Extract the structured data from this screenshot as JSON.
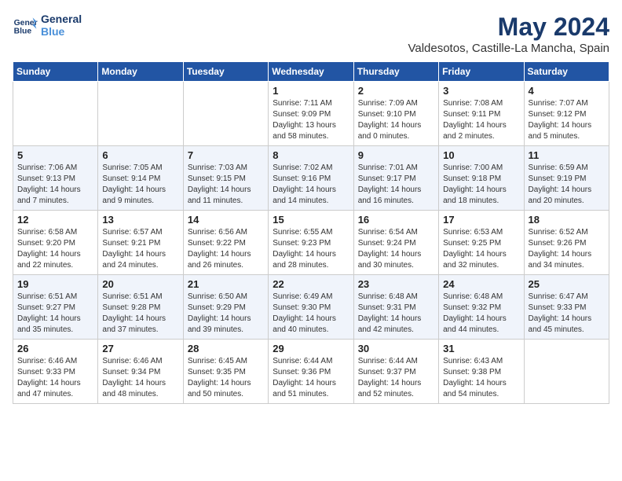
{
  "header": {
    "logo_line1": "General",
    "logo_line2": "Blue",
    "month": "May 2024",
    "location": "Valdesotos, Castille-La Mancha, Spain"
  },
  "days_of_week": [
    "Sunday",
    "Monday",
    "Tuesday",
    "Wednesday",
    "Thursday",
    "Friday",
    "Saturday"
  ],
  "weeks": [
    [
      {
        "day": "",
        "info": ""
      },
      {
        "day": "",
        "info": ""
      },
      {
        "day": "",
        "info": ""
      },
      {
        "day": "1",
        "info": "Sunrise: 7:11 AM\nSunset: 9:09 PM\nDaylight: 13 hours\nand 58 minutes."
      },
      {
        "day": "2",
        "info": "Sunrise: 7:09 AM\nSunset: 9:10 PM\nDaylight: 14 hours\nand 0 minutes."
      },
      {
        "day": "3",
        "info": "Sunrise: 7:08 AM\nSunset: 9:11 PM\nDaylight: 14 hours\nand 2 minutes."
      },
      {
        "day": "4",
        "info": "Sunrise: 7:07 AM\nSunset: 9:12 PM\nDaylight: 14 hours\nand 5 minutes."
      }
    ],
    [
      {
        "day": "5",
        "info": "Sunrise: 7:06 AM\nSunset: 9:13 PM\nDaylight: 14 hours\nand 7 minutes."
      },
      {
        "day": "6",
        "info": "Sunrise: 7:05 AM\nSunset: 9:14 PM\nDaylight: 14 hours\nand 9 minutes."
      },
      {
        "day": "7",
        "info": "Sunrise: 7:03 AM\nSunset: 9:15 PM\nDaylight: 14 hours\nand 11 minutes."
      },
      {
        "day": "8",
        "info": "Sunrise: 7:02 AM\nSunset: 9:16 PM\nDaylight: 14 hours\nand 14 minutes."
      },
      {
        "day": "9",
        "info": "Sunrise: 7:01 AM\nSunset: 9:17 PM\nDaylight: 14 hours\nand 16 minutes."
      },
      {
        "day": "10",
        "info": "Sunrise: 7:00 AM\nSunset: 9:18 PM\nDaylight: 14 hours\nand 18 minutes."
      },
      {
        "day": "11",
        "info": "Sunrise: 6:59 AM\nSunset: 9:19 PM\nDaylight: 14 hours\nand 20 minutes."
      }
    ],
    [
      {
        "day": "12",
        "info": "Sunrise: 6:58 AM\nSunset: 9:20 PM\nDaylight: 14 hours\nand 22 minutes."
      },
      {
        "day": "13",
        "info": "Sunrise: 6:57 AM\nSunset: 9:21 PM\nDaylight: 14 hours\nand 24 minutes."
      },
      {
        "day": "14",
        "info": "Sunrise: 6:56 AM\nSunset: 9:22 PM\nDaylight: 14 hours\nand 26 minutes."
      },
      {
        "day": "15",
        "info": "Sunrise: 6:55 AM\nSunset: 9:23 PM\nDaylight: 14 hours\nand 28 minutes."
      },
      {
        "day": "16",
        "info": "Sunrise: 6:54 AM\nSunset: 9:24 PM\nDaylight: 14 hours\nand 30 minutes."
      },
      {
        "day": "17",
        "info": "Sunrise: 6:53 AM\nSunset: 9:25 PM\nDaylight: 14 hours\nand 32 minutes."
      },
      {
        "day": "18",
        "info": "Sunrise: 6:52 AM\nSunset: 9:26 PM\nDaylight: 14 hours\nand 34 minutes."
      }
    ],
    [
      {
        "day": "19",
        "info": "Sunrise: 6:51 AM\nSunset: 9:27 PM\nDaylight: 14 hours\nand 35 minutes."
      },
      {
        "day": "20",
        "info": "Sunrise: 6:51 AM\nSunset: 9:28 PM\nDaylight: 14 hours\nand 37 minutes."
      },
      {
        "day": "21",
        "info": "Sunrise: 6:50 AM\nSunset: 9:29 PM\nDaylight: 14 hours\nand 39 minutes."
      },
      {
        "day": "22",
        "info": "Sunrise: 6:49 AM\nSunset: 9:30 PM\nDaylight: 14 hours\nand 40 minutes."
      },
      {
        "day": "23",
        "info": "Sunrise: 6:48 AM\nSunset: 9:31 PM\nDaylight: 14 hours\nand 42 minutes."
      },
      {
        "day": "24",
        "info": "Sunrise: 6:48 AM\nSunset: 9:32 PM\nDaylight: 14 hours\nand 44 minutes."
      },
      {
        "day": "25",
        "info": "Sunrise: 6:47 AM\nSunset: 9:33 PM\nDaylight: 14 hours\nand 45 minutes."
      }
    ],
    [
      {
        "day": "26",
        "info": "Sunrise: 6:46 AM\nSunset: 9:33 PM\nDaylight: 14 hours\nand 47 minutes."
      },
      {
        "day": "27",
        "info": "Sunrise: 6:46 AM\nSunset: 9:34 PM\nDaylight: 14 hours\nand 48 minutes."
      },
      {
        "day": "28",
        "info": "Sunrise: 6:45 AM\nSunset: 9:35 PM\nDaylight: 14 hours\nand 50 minutes."
      },
      {
        "day": "29",
        "info": "Sunrise: 6:44 AM\nSunset: 9:36 PM\nDaylight: 14 hours\nand 51 minutes."
      },
      {
        "day": "30",
        "info": "Sunrise: 6:44 AM\nSunset: 9:37 PM\nDaylight: 14 hours\nand 52 minutes."
      },
      {
        "day": "31",
        "info": "Sunrise: 6:43 AM\nSunset: 9:38 PM\nDaylight: 14 hours\nand 54 minutes."
      },
      {
        "day": "",
        "info": ""
      }
    ]
  ]
}
